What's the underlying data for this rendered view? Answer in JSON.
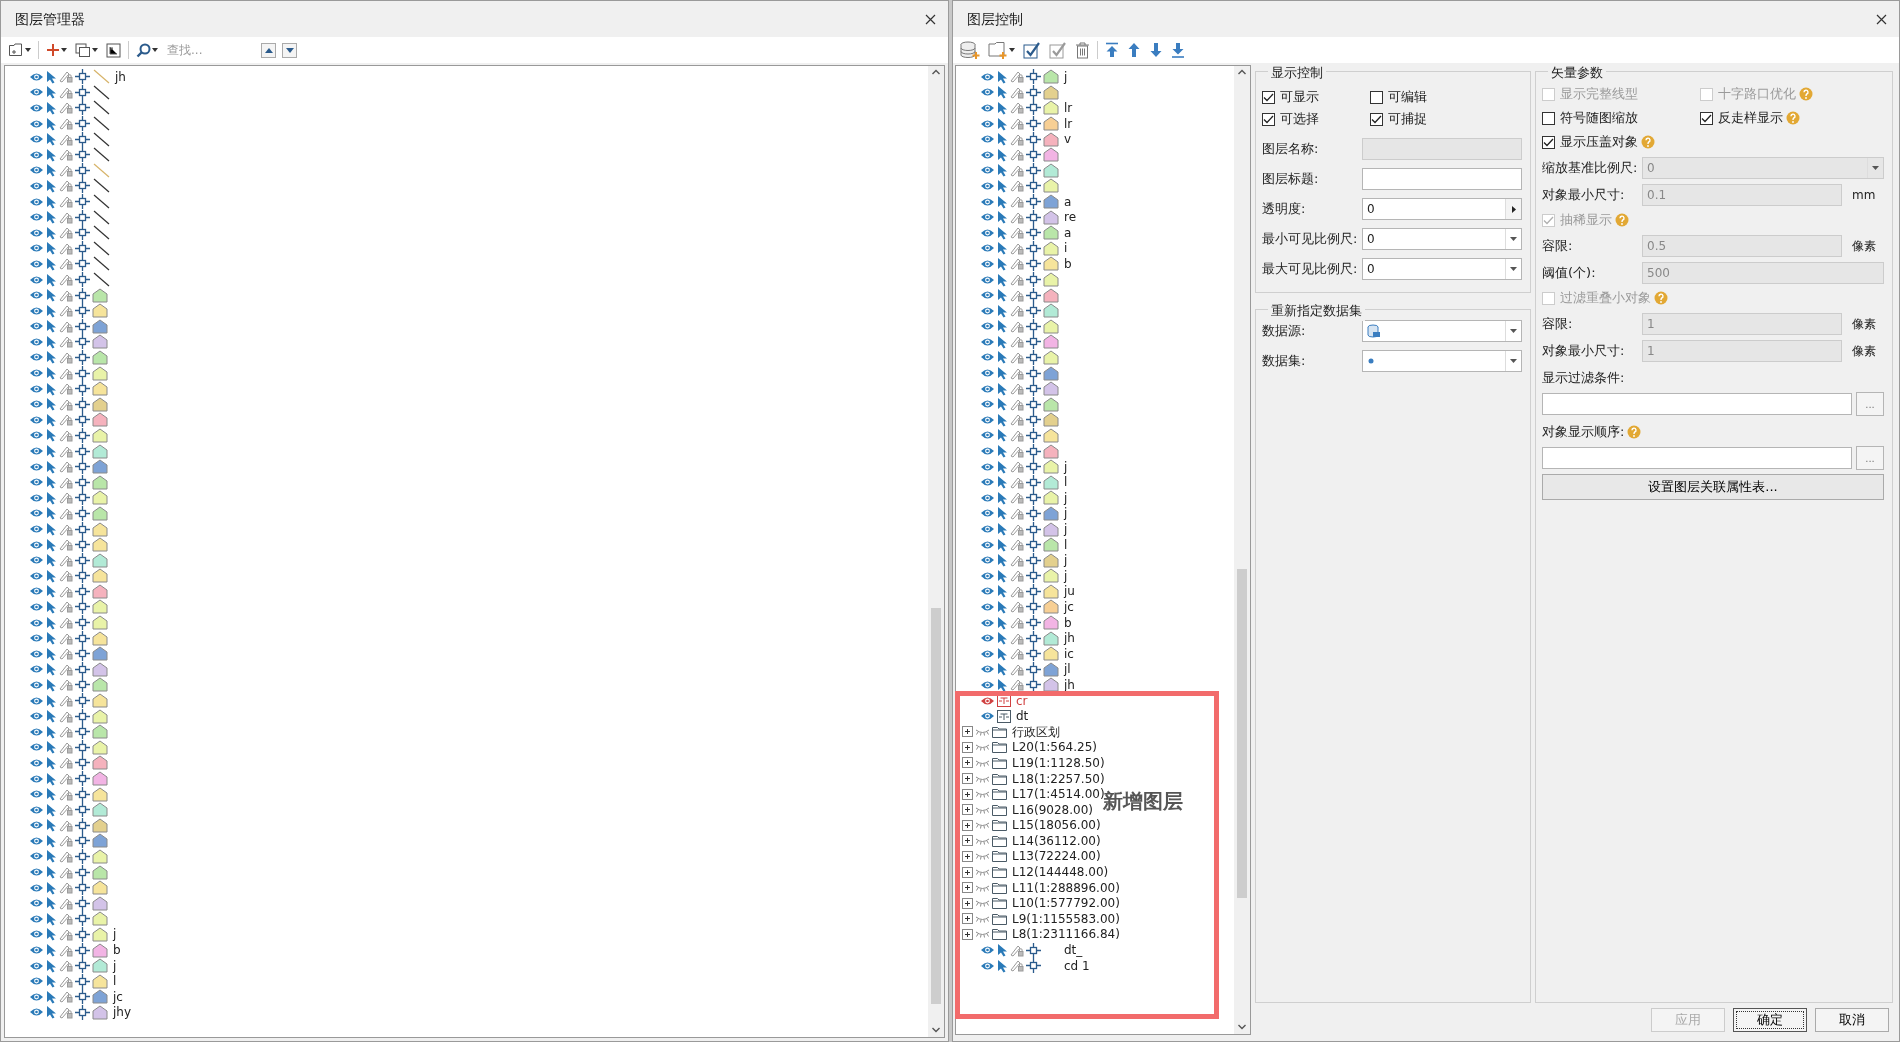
{
  "layer_manager": {
    "title": "图层管理器",
    "search": {
      "placeholder": "查找..."
    },
    "layers": [
      {
        "kind": "line",
        "color": "#d7b46a",
        "name": "jh"
      },
      {
        "kind": "line",
        "color": "#333333"
      },
      {
        "kind": "line",
        "color": "#333333"
      },
      {
        "kind": "line",
        "color": "#333333"
      },
      {
        "kind": "line",
        "color": "#333333"
      },
      {
        "kind": "line",
        "color": "#333333"
      },
      {
        "kind": "line",
        "color": "#d7b46a"
      },
      {
        "kind": "line",
        "color": "#333333"
      },
      {
        "kind": "line",
        "color": "#333333"
      },
      {
        "kind": "line",
        "color": "#333333"
      },
      {
        "kind": "line",
        "color": "#333333"
      },
      {
        "kind": "line",
        "color": "#333333"
      },
      {
        "kind": "line",
        "color": "#333333"
      },
      {
        "kind": "line",
        "color": "#333333"
      },
      {
        "kind": "region",
        "color": "#b9e6a9"
      },
      {
        "kind": "region",
        "color": "#f6e49b"
      },
      {
        "kind": "region",
        "color": "#7ea3d6"
      },
      {
        "kind": "region",
        "color": "#d3c3e8"
      },
      {
        "kind": "region",
        "color": "#b9e6a9"
      },
      {
        "kind": "region",
        "color": "#e9f3a8"
      },
      {
        "kind": "region",
        "color": "#f6e49b"
      },
      {
        "kind": "region",
        "color": "#e3d08e"
      },
      {
        "kind": "region",
        "color": "#f5b2bd"
      },
      {
        "kind": "region",
        "color": "#e9f3a8"
      },
      {
        "kind": "region",
        "color": "#b2ead6"
      },
      {
        "kind": "region",
        "color": "#7ea3d6"
      },
      {
        "kind": "region",
        "color": "#b9e6a9"
      },
      {
        "kind": "region",
        "color": "#e9f3a8"
      },
      {
        "kind": "region",
        "color": "#b9e6a9"
      },
      {
        "kind": "region",
        "color": "#f6e49b"
      },
      {
        "kind": "region",
        "color": "#f6e49b"
      },
      {
        "kind": "region",
        "color": "#b2ead6"
      },
      {
        "kind": "region",
        "color": "#f6e49b"
      },
      {
        "kind": "region",
        "color": "#f5b2bd"
      },
      {
        "kind": "region",
        "color": "#e9f3a8"
      },
      {
        "kind": "region",
        "color": "#e9f3a8"
      },
      {
        "kind": "region",
        "color": "#f6e49b"
      },
      {
        "kind": "region",
        "color": "#7ea3d6"
      },
      {
        "kind": "region",
        "color": "#d3c3e8"
      },
      {
        "kind": "region",
        "color": "#b9e6a9"
      },
      {
        "kind": "region",
        "color": "#f6e49b"
      },
      {
        "kind": "region",
        "color": "#e9f3a8"
      },
      {
        "kind": "region",
        "color": "#b9e6a9"
      },
      {
        "kind": "region",
        "color": "#e9f3a8"
      },
      {
        "kind": "region",
        "color": "#f5b2bd"
      },
      {
        "kind": "region",
        "color": "#f2b4e4"
      },
      {
        "kind": "region",
        "color": "#f6e49b"
      },
      {
        "kind": "region",
        "color": "#b2ead6"
      },
      {
        "kind": "region",
        "color": "#e3d08e"
      },
      {
        "kind": "region",
        "color": "#7ea3d6"
      },
      {
        "kind": "region",
        "color": "#e9f3a8"
      },
      {
        "kind": "region",
        "color": "#b9e6a9"
      },
      {
        "kind": "region",
        "color": "#f6e49b"
      },
      {
        "kind": "region",
        "color": "#d3c3e8"
      },
      {
        "kind": "region",
        "color": "#e9f3a8"
      },
      {
        "kind": "region",
        "color": "#e9f3a8",
        "name": "j"
      },
      {
        "kind": "region",
        "color": "#f2b4e4",
        "name": "b"
      },
      {
        "kind": "region",
        "color": "#b2ead6",
        "name": "j"
      },
      {
        "kind": "region",
        "color": "#f6e49b",
        "name": "l"
      },
      {
        "kind": "region",
        "color": "#7ea3d6",
        "name": "jc"
      },
      {
        "kind": "region",
        "color": "#d3c3e8",
        "name": "jhy"
      }
    ]
  },
  "layer_control": {
    "title": "图层控制",
    "annotation": {
      "label": "新增图层"
    },
    "layers": [
      {
        "kind": "region",
        "color": "#b9e6a9",
        "name": "j"
      },
      {
        "kind": "region",
        "color": "#e3d08e"
      },
      {
        "kind": "region",
        "color": "#e9f3a8",
        "name": "lr"
      },
      {
        "kind": "region",
        "color": "#f7cf94",
        "name": "lr"
      },
      {
        "kind": "region",
        "color": "#f5b2bd",
        "name": "v"
      },
      {
        "kind": "region",
        "color": "#f2b4e4"
      },
      {
        "kind": "region",
        "color": "#b2ead6"
      },
      {
        "kind": "region",
        "color": "#e9f3a8"
      },
      {
        "kind": "region",
        "color": "#7ea3d6",
        "name": "a"
      },
      {
        "kind": "region",
        "color": "#d3c3e8",
        "name": "re"
      },
      {
        "kind": "region",
        "color": "#b9e6a9",
        "name": "a"
      },
      {
        "kind": "region",
        "color": "#e9f3a8",
        "name": "i"
      },
      {
        "kind": "region",
        "color": "#f6e49b",
        "name": "b"
      },
      {
        "kind": "region",
        "color": "#e9f3a8"
      },
      {
        "kind": "region",
        "color": "#f5b2bd"
      },
      {
        "kind": "region",
        "color": "#b2ead6"
      },
      {
        "kind": "region",
        "color": "#e9f3a8"
      },
      {
        "kind": "region",
        "color": "#f2b4e4"
      },
      {
        "kind": "region",
        "color": "#e9f3a8"
      },
      {
        "kind": "region",
        "color": "#7ea3d6"
      },
      {
        "kind": "region",
        "color": "#d3c3e8"
      },
      {
        "kind": "region",
        "color": "#b9e6a9"
      },
      {
        "kind": "region",
        "color": "#e3d08e"
      },
      {
        "kind": "region",
        "color": "#f6e49b"
      },
      {
        "kind": "region",
        "color": "#f5b2bd"
      },
      {
        "kind": "region",
        "color": "#e9f3a8",
        "name": "j"
      },
      {
        "kind": "region",
        "color": "#b2ead6",
        "name": "l"
      },
      {
        "kind": "region",
        "color": "#e9f3a8",
        "name": "j"
      },
      {
        "kind": "region",
        "color": "#7ea3d6",
        "name": "j"
      },
      {
        "kind": "region",
        "color": "#d3c3e8",
        "name": "j"
      },
      {
        "kind": "region",
        "color": "#b9e6a9",
        "name": "l"
      },
      {
        "kind": "region",
        "color": "#e3d08e",
        "name": "j"
      },
      {
        "kind": "region",
        "color": "#e9f3a8",
        "name": "j"
      },
      {
        "kind": "region",
        "color": "#f6e49b",
        "name": "ju"
      },
      {
        "kind": "region",
        "color": "#f7cf94",
        "name": "jc"
      },
      {
        "kind": "region",
        "color": "#f2b4e4",
        "name": "b"
      },
      {
        "kind": "region",
        "color": "#b2ead6",
        "name": "jh"
      },
      {
        "kind": "region",
        "color": "#f6e49b",
        "name": "ic"
      },
      {
        "kind": "region",
        "color": "#7ea3d6",
        "name": "jl"
      },
      {
        "kind": "region",
        "color": "#d3c3e8",
        "name": "jh"
      },
      {
        "kind": "text",
        "name": "cr",
        "invalid": true
      },
      {
        "kind": "text",
        "name": "dt",
        "invalid": false
      },
      {
        "kind": "group",
        "name": "行政区划"
      },
      {
        "kind": "group",
        "name": "L20(1:564.25)"
      },
      {
        "kind": "group",
        "name": "L19(1:1128.50)"
      },
      {
        "kind": "group",
        "name": "L18(1:2257.50)"
      },
      {
        "kind": "group",
        "name": "L17(1:4514.00)"
      },
      {
        "kind": "group",
        "name": "L16(9028.00)"
      },
      {
        "kind": "group",
        "name": "L15(18056.00)"
      },
      {
        "kind": "group",
        "name": "L14(36112.00)"
      },
      {
        "kind": "group",
        "name": "L13(72224.00)"
      },
      {
        "kind": "group",
        "name": "L12(144448.00)"
      },
      {
        "kind": "group",
        "name": "L11(1:288896.00)"
      },
      {
        "kind": "group",
        "name": "L10(1:577792.00)"
      },
      {
        "kind": "group",
        "name": "L9(1:1155583.00)"
      },
      {
        "kind": "group",
        "name": "L8(1:2311166.84)"
      },
      {
        "kind": "point",
        "name": "dt_"
      },
      {
        "kind": "point",
        "name": "cd 1"
      }
    ],
    "display_control": {
      "title": "显示控制",
      "checks": [
        {
          "label": "可显示",
          "checked": true
        },
        {
          "label": "可编辑",
          "checked": false
        },
        {
          "label": "可选择",
          "checked": true
        },
        {
          "label": "可捕捉",
          "checked": true
        }
      ],
      "fields": [
        {
          "label": "图层名称:",
          "kind": "text",
          "disabled": true
        },
        {
          "label": "图层标题:",
          "kind": "text",
          "disabled": false
        },
        {
          "label": "透明度:",
          "kind": "spin",
          "value": "0",
          "disabled": false
        },
        {
          "label": "最小可见比例尺:",
          "kind": "combo",
          "value": "0",
          "disabled": false
        },
        {
          "label": "最大可见比例尺:",
          "kind": "combo",
          "value": "0",
          "disabled": false
        }
      ]
    },
    "dataset": {
      "title": "重新指定数据集",
      "fields": [
        {
          "label": "数据源:",
          "kind": "datasource"
        },
        {
          "label": "数据集:",
          "kind": "dataset"
        }
      ]
    },
    "vector": {
      "title": "矢量参数",
      "items": [
        {
          "kind": "checks",
          "checks": [
            {
              "label": "显示完整线型",
              "checked": false,
              "disabled": true
            },
            {
              "label": "十字路口优化",
              "checked": false,
              "disabled": true,
              "help": true
            }
          ]
        },
        {
          "kind": "checks",
          "checks": [
            {
              "label": "符号随图缩放",
              "checked": false,
              "disabled": false
            },
            {
              "label": "反走样显示",
              "checked": true,
              "disabled": false,
              "help": true
            }
          ]
        },
        {
          "kind": "checks",
          "checks": [
            {
              "label": "显示压盖对象",
              "checked": true,
              "disabled": false,
              "help": true
            }
          ]
        },
        {
          "kind": "combo",
          "label": "缩放基准比例尺:",
          "value": "0",
          "disabled": true
        },
        {
          "kind": "field",
          "label": "对象最小尺寸:",
          "value": "0.1",
          "unit": "mm",
          "disabled": true
        },
        {
          "kind": "checks",
          "checks": [
            {
              "label": "抽稀显示",
              "checked": true,
              "disabled": true,
              "help": true
            }
          ]
        },
        {
          "kind": "field",
          "label": "容限:",
          "value": "0.5",
          "unit": "像素",
          "disabled": true
        },
        {
          "kind": "field",
          "label": "阈值(个):",
          "value": "500",
          "disabled": true
        },
        {
          "kind": "checks",
          "checks": [
            {
              "label": "过滤重叠小对象",
              "checked": false,
              "disabled": true,
              "help": true
            }
          ]
        },
        {
          "kind": "field",
          "label": "容限:",
          "value": "1",
          "unit": "像素",
          "disabled": true
        },
        {
          "kind": "field",
          "label": "对象最小尺寸:",
          "value": "1",
          "unit": "像素",
          "disabled": true
        },
        {
          "kind": "caption",
          "label": "显示过滤条件:"
        },
        {
          "kind": "picker",
          "button": "..."
        },
        {
          "kind": "caption",
          "label": "对象显示顺序:",
          "help": true
        },
        {
          "kind": "picker",
          "button": "..."
        },
        {
          "kind": "button",
          "label": "设置图层关联属性表..."
        }
      ]
    },
    "buttons": [
      {
        "label": "应用",
        "disabled": true,
        "focused": false
      },
      {
        "label": "确定",
        "disabled": false,
        "focused": true
      },
      {
        "label": "取消",
        "disabled": false,
        "focused": false
      }
    ]
  }
}
